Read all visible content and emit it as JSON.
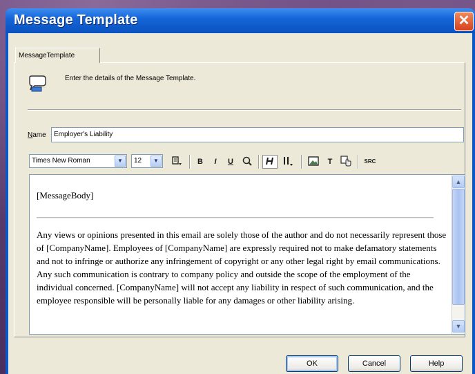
{
  "window": {
    "title": "Message Template",
    "close_label": "✕"
  },
  "tab": {
    "label": "MessageTemplate"
  },
  "instructions": "Enter the details of the Message Template.",
  "name_field": {
    "label_accel": "N",
    "label_rest": "ame",
    "value": "Employer's Liability"
  },
  "toolbar": {
    "font_family": "Times New Roman",
    "font_size": "12",
    "dropdown_arrow": "▼",
    "bold": "B",
    "italic": "I",
    "underline": "U",
    "text": "T",
    "source": "SRC"
  },
  "editor": {
    "message_body": "[MessageBody]",
    "disclaimer": "Any views or opinions presented in this email are solely those of the author and do not necessarily represent those of [CompanyName]. Employees of [CompanyName] are expressly required not to make defamatory statements and not to infringe or authorize any infringement of copyright or any other legal right by email communications. Any such communication is contrary to company policy and outside the scope of the employment of the individual concerned. [CompanyName] will not accept any liability in respect of such communication, and the employee responsible will be personally liable for any damages or other liability arising."
  },
  "scrollbar": {
    "up": "▲",
    "down": "▼"
  },
  "buttons": {
    "ok": "OK",
    "cancel": "Cancel",
    "help": "Help"
  }
}
